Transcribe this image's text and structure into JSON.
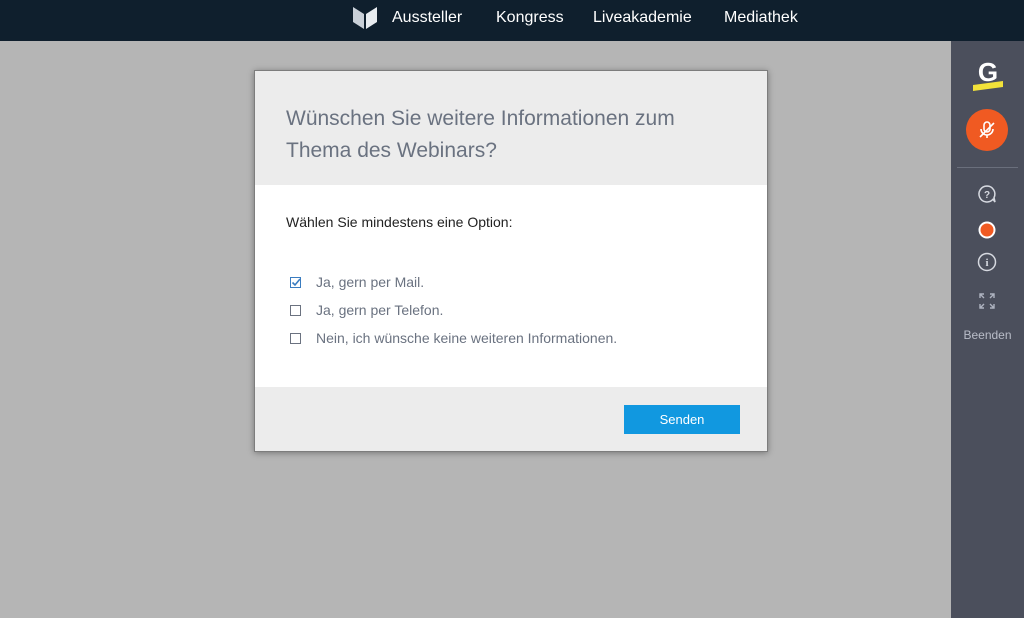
{
  "nav": {
    "logo_icon": "brand-logo-icon",
    "links": [
      "Aussteller",
      "Kongress",
      "Liveakademie",
      "Mediathek"
    ]
  },
  "rail": {
    "brand_icon": "g-logo-icon",
    "mic_icon": "mic-muted-icon",
    "mic_color": "#f05a22",
    "icons": [
      "help-chat-icon",
      "record-icon",
      "info-icon",
      "fullscreen-icon"
    ],
    "exit_label": "Beenden"
  },
  "modal": {
    "title": "Wünschen Sie weitere Informationen zum Thema des Webinars?",
    "prompt": "Wählen Sie mindestens eine Option:",
    "options": [
      {
        "label": "Ja, gern per Mail.",
        "checked": true
      },
      {
        "label": "Ja, gern per Telefon.",
        "checked": false
      },
      {
        "label": "Nein, ich wünsche keine weiteren Informationen.",
        "checked": false
      }
    ],
    "submit_label": "Senden",
    "accent": "#1198e0"
  }
}
